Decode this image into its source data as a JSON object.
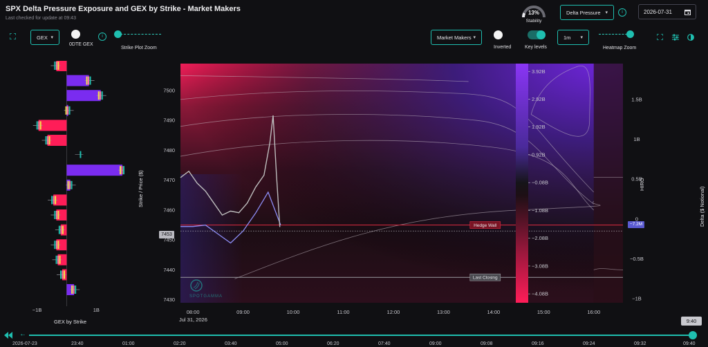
{
  "header": {
    "title": "SPX Delta Pressure Exposure and GEX by Strike - Market Makers",
    "subtitle": "Last checked for update at 09:43",
    "stability_value": "13%",
    "stability_label": "Stability",
    "stability_fraction": 0.13,
    "measure_select": "Delta Pressure",
    "date": "2026-07-31"
  },
  "controls": {
    "gex_select": "GEX",
    "odte_label": "0DTE GEX",
    "strike_zoom_label": "Strike Plot Zoom",
    "dealer_select": "Market Makers",
    "inverted_label": "Inverted",
    "key_levels_label": "Key levels",
    "interval_select": "1m",
    "heatmap_zoom_label": "Heatmap Zoom",
    "odte_on": false,
    "inverted_on": false,
    "key_levels_on": true
  },
  "colors": {
    "accent": "#1fbfb0",
    "positive": "#7a2cf0",
    "negative": "#ff1d58",
    "price": "#8d8df5",
    "hiro": "#bdbdbd"
  },
  "chart_data": [
    {
      "type": "bar",
      "orientation": "horizontal",
      "xlabel": "GEX by Strike",
      "x_ticks": [
        "−1B",
        "1B"
      ],
      "x_tick_values": [
        -1,
        1
      ],
      "xlim": [
        -1.55,
        1.95
      ],
      "strikes": [
        7505,
        7500,
        7495,
        7490,
        7485,
        7480,
        7475,
        7470,
        7465,
        7460,
        7455,
        7450,
        7445,
        7440,
        7435,
        7430
      ],
      "values": [
        -0.35,
        0.75,
        1.15,
        0.05,
        -0.95,
        -0.65,
        0.0,
        1.88,
        0.12,
        -0.45,
        -0.35,
        -0.2,
        -0.35,
        -0.3,
        -0.15,
        0.25
      ]
    },
    {
      "type": "heatmap",
      "ylabel": "Strike / Price ($)",
      "y_ticks": [
        7500,
        7490,
        7480,
        7470,
        7460,
        7450,
        7440,
        7430
      ],
      "ylim": [
        7429,
        7509
      ],
      "x_ticks": [
        "08:00",
        "09:00",
        "10:00",
        "11:00",
        "12:00",
        "13:00",
        "14:00",
        "15:00",
        "16:00"
      ],
      "x_date": "Jul 31, 2026",
      "xlim": [
        "07:45",
        "16:35"
      ],
      "current_price": "7453",
      "right_axis_label": "HIRO",
      "hiro_ticks": [
        "1.5B",
        "1B",
        "0.5B",
        "0",
        "−0.5B",
        "−1B"
      ],
      "hiro_tick_values": [
        1.5,
        1,
        0.5,
        0,
        -0.5,
        -1
      ],
      "hiro_current": "−7.2M",
      "levels": [
        {
          "name": "Hedge Wall",
          "strike": 7455
        },
        {
          "name": "Last Closing",
          "strike": 7437.5
        }
      ],
      "price": {
        "x": [
          "07:45",
          "08:00",
          "08:15",
          "08:30",
          "08:45",
          "09:00",
          "09:15",
          "09:30",
          "09:45"
        ],
        "y": [
          7454.5,
          7454.5,
          7455,
          7452,
          7449,
          7453,
          7459,
          7466,
          7455
        ]
      },
      "hiro": {
        "x": [
          "07:45",
          "07:55",
          "08:05",
          "08:15",
          "08:25",
          "08:35",
          "08:45",
          "08:55",
          "09:05",
          "09:15",
          "09:25",
          "09:32",
          "09:36",
          "09:40",
          "09:44"
        ],
        "y": [
          0.52,
          0.6,
          0.45,
          0.35,
          0.2,
          0.05,
          0.1,
          0.08,
          0.2,
          0.4,
          0.55,
          0.95,
          1.3,
          0.55,
          -0.1
        ]
      },
      "colorbar": {
        "label": "Delta ($ Notional)",
        "ticks": [
          "3.92B",
          "2.92B",
          "1.92B",
          "0.92B",
          "−0.08B",
          "−1.08B",
          "−2.08B",
          "−3.08B",
          "−4.08B"
        ],
        "range": [
          -4.4,
          4.2
        ]
      }
    }
  ],
  "timeline": {
    "labels": [
      "2026-07-23",
      "23:40",
      "01:00",
      "02:20",
      "03:40",
      "05:00",
      "06:20",
      "07:40",
      "09:00",
      "09:08",
      "09:16",
      "09:24",
      "09:32",
      "09:40"
    ],
    "current": "9:40"
  }
}
